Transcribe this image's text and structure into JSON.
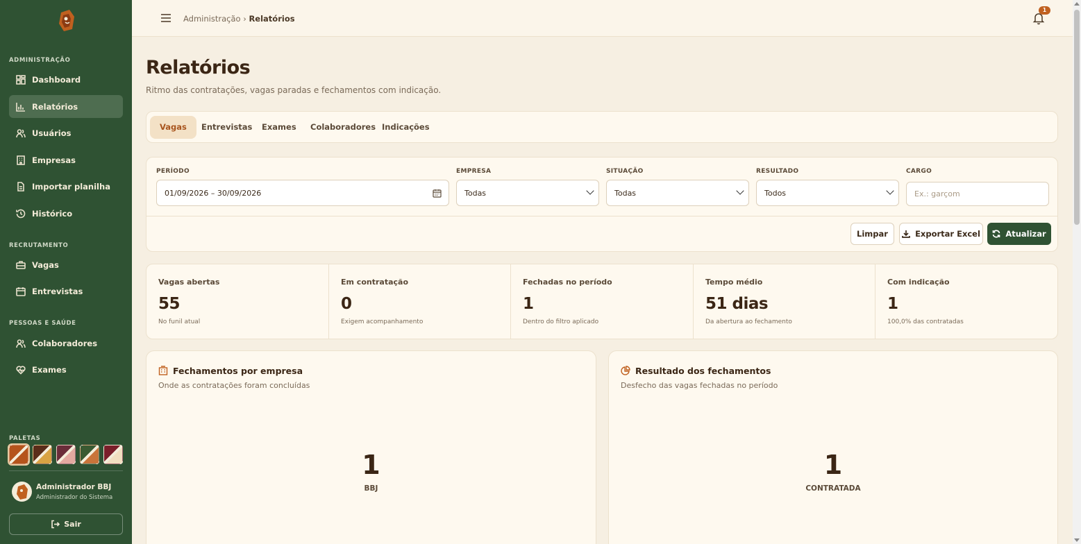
{
  "sidebar": {
    "sections": [
      {
        "title": "ADMINISTRAÇÃO"
      },
      {
        "title": "RECRUTAMENTO"
      },
      {
        "title": "PESSOAS E SAÚDE"
      }
    ],
    "items": [
      {
        "label": "Dashboard",
        "icon": "dashboard-icon"
      },
      {
        "label": "Relatórios",
        "icon": "bar-chart-icon",
        "active": true
      },
      {
        "label": "Usuários",
        "icon": "users-icon"
      },
      {
        "label": "Empresas",
        "icon": "building-icon"
      },
      {
        "label": "Importar planilha",
        "icon": "file-icon"
      },
      {
        "label": "Histórico",
        "icon": "history-icon"
      },
      {
        "label": "Vagas",
        "icon": "briefcase-icon"
      },
      {
        "label": "Entrevistas",
        "icon": "calendar-icon"
      },
      {
        "label": "Colaboradores",
        "icon": "users-icon"
      },
      {
        "label": "Exames",
        "icon": "heart-pulse-icon"
      }
    ],
    "palettes_title": "PALETAS",
    "palettes": [
      {
        "a": "#b5541c",
        "b": "#f4ecd9"
      },
      {
        "a": "#5a2d1a",
        "b": "#d9a343"
      },
      {
        "a": "#6b2d3a",
        "b": "#e3a9a0"
      },
      {
        "a": "#3a5a32",
        "b": "#c9743a"
      },
      {
        "a": "#7a1f2a",
        "b": "#f2dfc0"
      }
    ],
    "user": {
      "name": "Administrador BBJ",
      "role": "Administrador do Sistema"
    },
    "logout_label": "Sair"
  },
  "topbar": {
    "crumb_parent": "Administração",
    "crumb_sep": "›",
    "crumb_current": "Relatórios",
    "notifications": "1"
  },
  "page": {
    "title": "Relatórios",
    "subtitle": "Ritmo das contratações, vagas paradas e fechamentos com indicação."
  },
  "tabs": [
    "Vagas",
    "Entrevistas",
    "Exames",
    "Colaboradores",
    "Indicações"
  ],
  "filters": {
    "periodo_label": "PERÍODO",
    "periodo_value": "01/09/2026 – 30/09/2026",
    "empresa_label": "EMPRESA",
    "empresa_value": "Todas",
    "situacao_label": "SITUAÇÃO",
    "situacao_value": "Todas",
    "resultado_label": "RESULTADO",
    "resultado_value": "Todos",
    "cargo_label": "CARGO",
    "cargo_placeholder": "Ex.: garçom",
    "btn_clear": "Limpar",
    "btn_export": "Exportar Excel",
    "btn_refresh": "Atualizar"
  },
  "stats": [
    {
      "label": "Vagas abertas",
      "value": "55",
      "note": "No funil atual"
    },
    {
      "label": "Em contratação",
      "value": "0",
      "note": "Exigem acompanhamento"
    },
    {
      "label": "Fechadas no período",
      "value": "1",
      "note": "Dentro do filtro aplicado"
    },
    {
      "label": "Tempo médio",
      "value": "51 dias",
      "note": "Da abertura ao fechamento"
    },
    {
      "label": "Com indicação",
      "value": "1",
      "note": "100,0% das contratadas"
    }
  ],
  "cards": [
    {
      "title": "Fechamentos por empresa",
      "subtitle": "Onde as contratações foram concluídas",
      "value": "1",
      "value_label": "BBJ"
    },
    {
      "title": "Resultado dos fechamentos",
      "subtitle": "Desfecho das vagas fechadas no período",
      "value": "1",
      "value_label": "CONTRATADA"
    }
  ],
  "colors": {
    "sidebar": "#2f5233",
    "accent": "#c0601f",
    "background": "#f6efe2"
  }
}
